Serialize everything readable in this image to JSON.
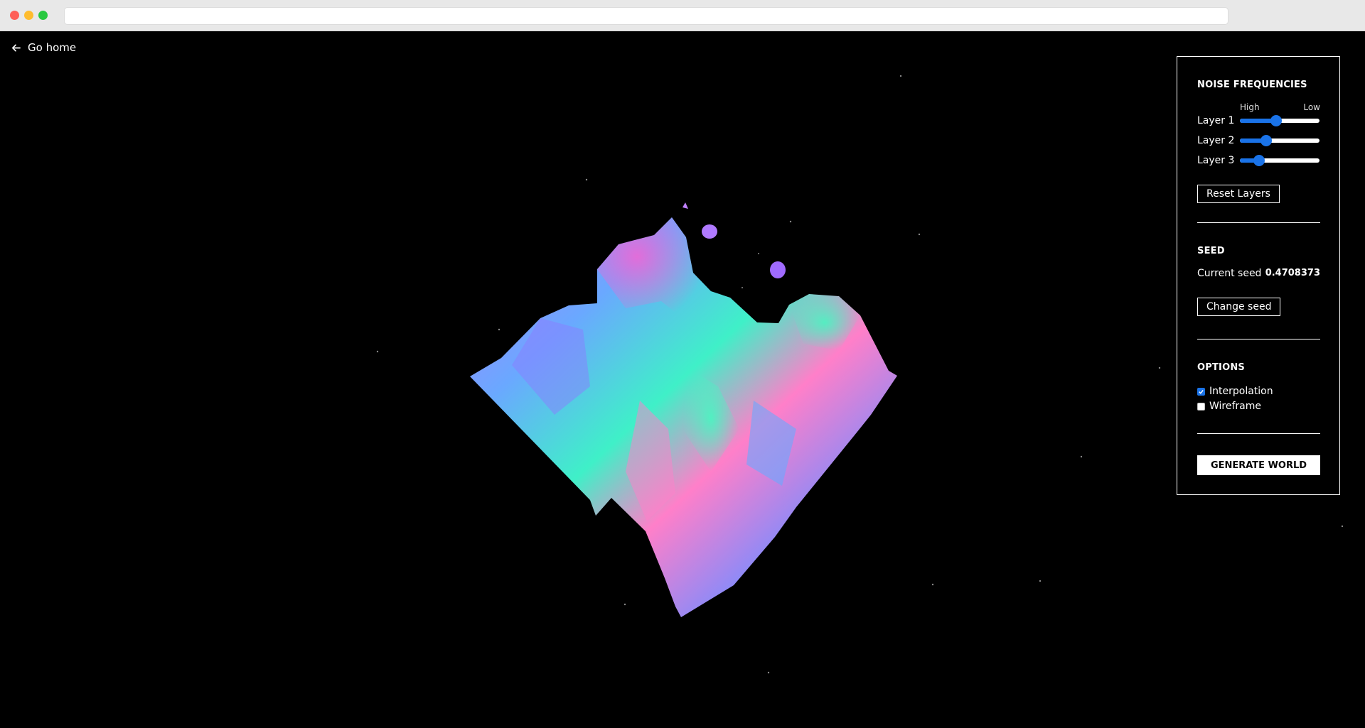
{
  "nav": {
    "go_home_label": "Go home"
  },
  "noise": {
    "title": "NOISE FREQUENCIES",
    "high_label": "High",
    "low_label": "Low",
    "layers": [
      {
        "label": "Layer 1",
        "value": 0.45
      },
      {
        "label": "Layer 2",
        "value": 0.3
      },
      {
        "label": "Layer 3",
        "value": 0.2
      }
    ],
    "reset_label": "Reset Layers"
  },
  "seed": {
    "title": "SEED",
    "current_label": "Current seed",
    "current_value": "0.4708373",
    "change_label": "Change seed"
  },
  "options": {
    "title": "OPTIONS",
    "interpolation_label": "Interpolation",
    "interpolation_checked": true,
    "wireframe_label": "Wireframe",
    "wireframe_checked": false
  },
  "generate_label": "GENERATE WORLD",
  "colors": {
    "accent": "#1a73e8",
    "background": "#000000",
    "panel_border": "#ffffff"
  }
}
